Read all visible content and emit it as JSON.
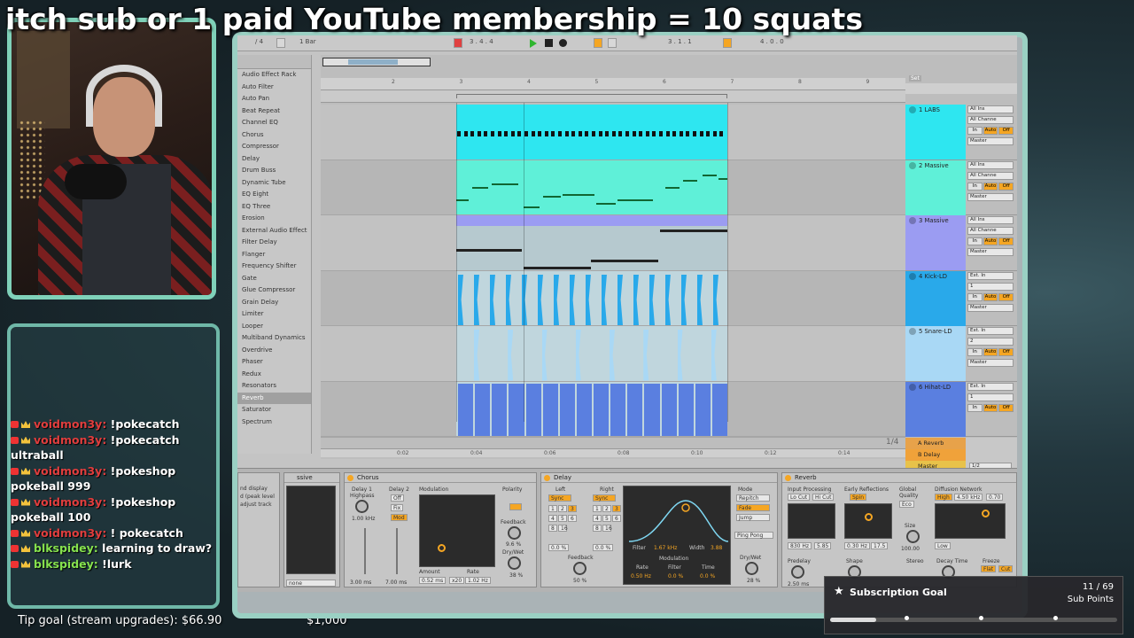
{
  "banner": "itch sub or 1 paid YouTube membership = 10 squats",
  "chat": [
    {
      "user": "voidmon3y:",
      "msg": " !pokecatch",
      "color": "red"
    },
    {
      "user": "voidmon3y:",
      "msg": " !pokecatch ultraball",
      "color": "red"
    },
    {
      "user": "voidmon3y:",
      "msg": " !pokeshop pokeball 999",
      "color": "red"
    },
    {
      "user": "voidmon3y:",
      "msg": " !pokeshop pokeball 100",
      "color": "red"
    },
    {
      "user": "voidmon3y:",
      "msg": " ! pokecatch",
      "color": "red"
    },
    {
      "user": "blkspidey:",
      "msg": " learning to draw?",
      "color": "green"
    },
    {
      "user": "blkspidey:",
      "msg": " !lurk",
      "color": "green"
    }
  ],
  "tip_goal": "Tip goal (stream upgrades): $66.90",
  "tip_target": "$1,000",
  "daw": {
    "toolbar": {
      "bar_select": "1 Bar",
      "position": "3 . 4 . 4",
      "loop_start": "3 . 1 . 1",
      "loop_len": "4 . 0 . 0",
      "beat_a": "/ 4",
      "set_label": "Set"
    },
    "browser": [
      "Audio Effect Rack",
      "Auto Filter",
      "Auto Pan",
      "Beat Repeat",
      "Channel EQ",
      "Chorus",
      "Compressor",
      "Delay",
      "Drum Buss",
      "Dynamic Tube",
      "EQ Eight",
      "EQ Three",
      "Erosion",
      "External Audio Effect",
      "Filter Delay",
      "Flanger",
      "Frequency Shifter",
      "Gate",
      "Glue Compressor",
      "Grain Delay",
      "Limiter",
      "Looper",
      "Multiband Dynamics",
      "Overdrive",
      "Phaser",
      "Redux",
      "Resonators",
      "Reverb",
      "Saturator",
      "Spectrum"
    ],
    "browser_selected": "Reverb",
    "ruler": [
      "2",
      "3",
      "4",
      "5",
      "6",
      "7",
      "8",
      "9"
    ],
    "bottom_ruler": [
      "0:02",
      "0:04",
      "0:06",
      "0:08",
      "0:10",
      "0:12",
      "0:14"
    ],
    "page_fraction": "1/4",
    "tracks": [
      {
        "name": "1 LABS",
        "color": "#2ee6f0",
        "in": "All Ins",
        "ch": "All Channe",
        "out": "Master"
      },
      {
        "name": "2 Massive",
        "color": "#5ff0d8",
        "in": "All Ins",
        "ch": "All Channe",
        "out": "Master"
      },
      {
        "name": "3 Massive",
        "color": "#9b9cf2",
        "in": "All Ins",
        "ch": "All Channe",
        "out": "Master"
      },
      {
        "name": "4 Kick-LD",
        "color": "#29a9ea",
        "in": "Ext. In",
        "ch": "1",
        "out": "Master"
      },
      {
        "name": "5 Snare-LD",
        "color": "#a9d8f5",
        "in": "Ext. In",
        "ch": "2",
        "out": "Master"
      },
      {
        "name": "6 Hihat-LD",
        "color": "#5a7fe0",
        "in": "Ext. In",
        "ch": "1",
        "out": ""
      }
    ],
    "returns": [
      {
        "name": "A Reverb",
        "color": "#e7a24a"
      },
      {
        "name": "B Delay",
        "color": "#f0a23a"
      },
      {
        "name": "Master",
        "color": "#e8c24a",
        "out": "1/2"
      }
    ],
    "monitor": {
      "in": "In",
      "auto": "Auto",
      "off": "Off"
    },
    "devices": {
      "massive_frag": "ssive",
      "utility_labels": [
        "nd display",
        "d (peak level",
        "adjust track"
      ],
      "utility_select": "none",
      "chorus": {
        "title": "Chorus",
        "delay1": "Delay 1",
        "highpass": "Highpass",
        "hp_val": "1.00 kHz",
        "delay2": "Delay 2",
        "modulation": "Modulation",
        "polarity": "Polarity",
        "off": "Off",
        "fix": "Fix",
        "mod": "Mod",
        "d1_ms": "3.00 ms",
        "d2_ms": "7.00 ms",
        "amount": "Amount",
        "rate": "Rate",
        "amount_val": "0.52 ms",
        "x20": "x20",
        "rate_val": "1.02 Hz",
        "feedback": "Feedback",
        "fb_val": "9.6 %",
        "drywet": "Dry/Wet",
        "dw_val": "38 %"
      },
      "delay": {
        "title": "Delay",
        "left": "Left",
        "right": "Right",
        "sync": "Sync",
        "nums": [
          "1",
          "2",
          "3",
          "4",
          "5",
          "6",
          "8",
          "16"
        ],
        "left_pct": "0.0 %",
        "right_pct": "0.0 %",
        "feedback": "Feedback",
        "fb_val": "50 %",
        "filter": "Filter",
        "filter_val": "1.67 kHz",
        "width": "Width",
        "width_val": "3.88",
        "modulation": "Modulation",
        "rate": "Rate",
        "rate_val": "0.50 Hz",
        "filter_mod": "Filter",
        "filter_mod_val": "0.0 %",
        "time": "Time",
        "time_val": "0.0 %",
        "mode": "Mode",
        "repitch": "Repitch",
        "fade": "Fade",
        "jump": "Jump",
        "pingpong": "Ping Pong",
        "drywet": "Dry/Wet",
        "dw_val": "28 %"
      },
      "reverb": {
        "title": "Reverb",
        "input": "Input Processing",
        "locut": "Lo Cut",
        "hicut": "Hi Cut",
        "early": "Early Reflections",
        "spin": "Spin",
        "global": "Global",
        "quality": "Quality",
        "eco": "Eco",
        "diffusion": "Diffusion Network",
        "high": "High",
        "high_val": "4.50 kHz",
        "high_pct": "0.70",
        "low": "Low",
        "size": "Size",
        "size_val": "100.00",
        "v1": "830 Hz",
        "v2": "5.85",
        "v3": "0.30 Hz",
        "v4": "17.5",
        "predelay": "Predelay",
        "predelay_val": "2.50 ms",
        "shape": "Shape",
        "stereo": "Stereo",
        "decay": "Decay Time",
        "freeze": "Freeze",
        "flat": "Flat",
        "cut": "Cut"
      }
    }
  },
  "subgoal": {
    "title": "Subscription Goal",
    "count": "11 / 69",
    "label": "Sub Points",
    "progress": 0.16
  }
}
